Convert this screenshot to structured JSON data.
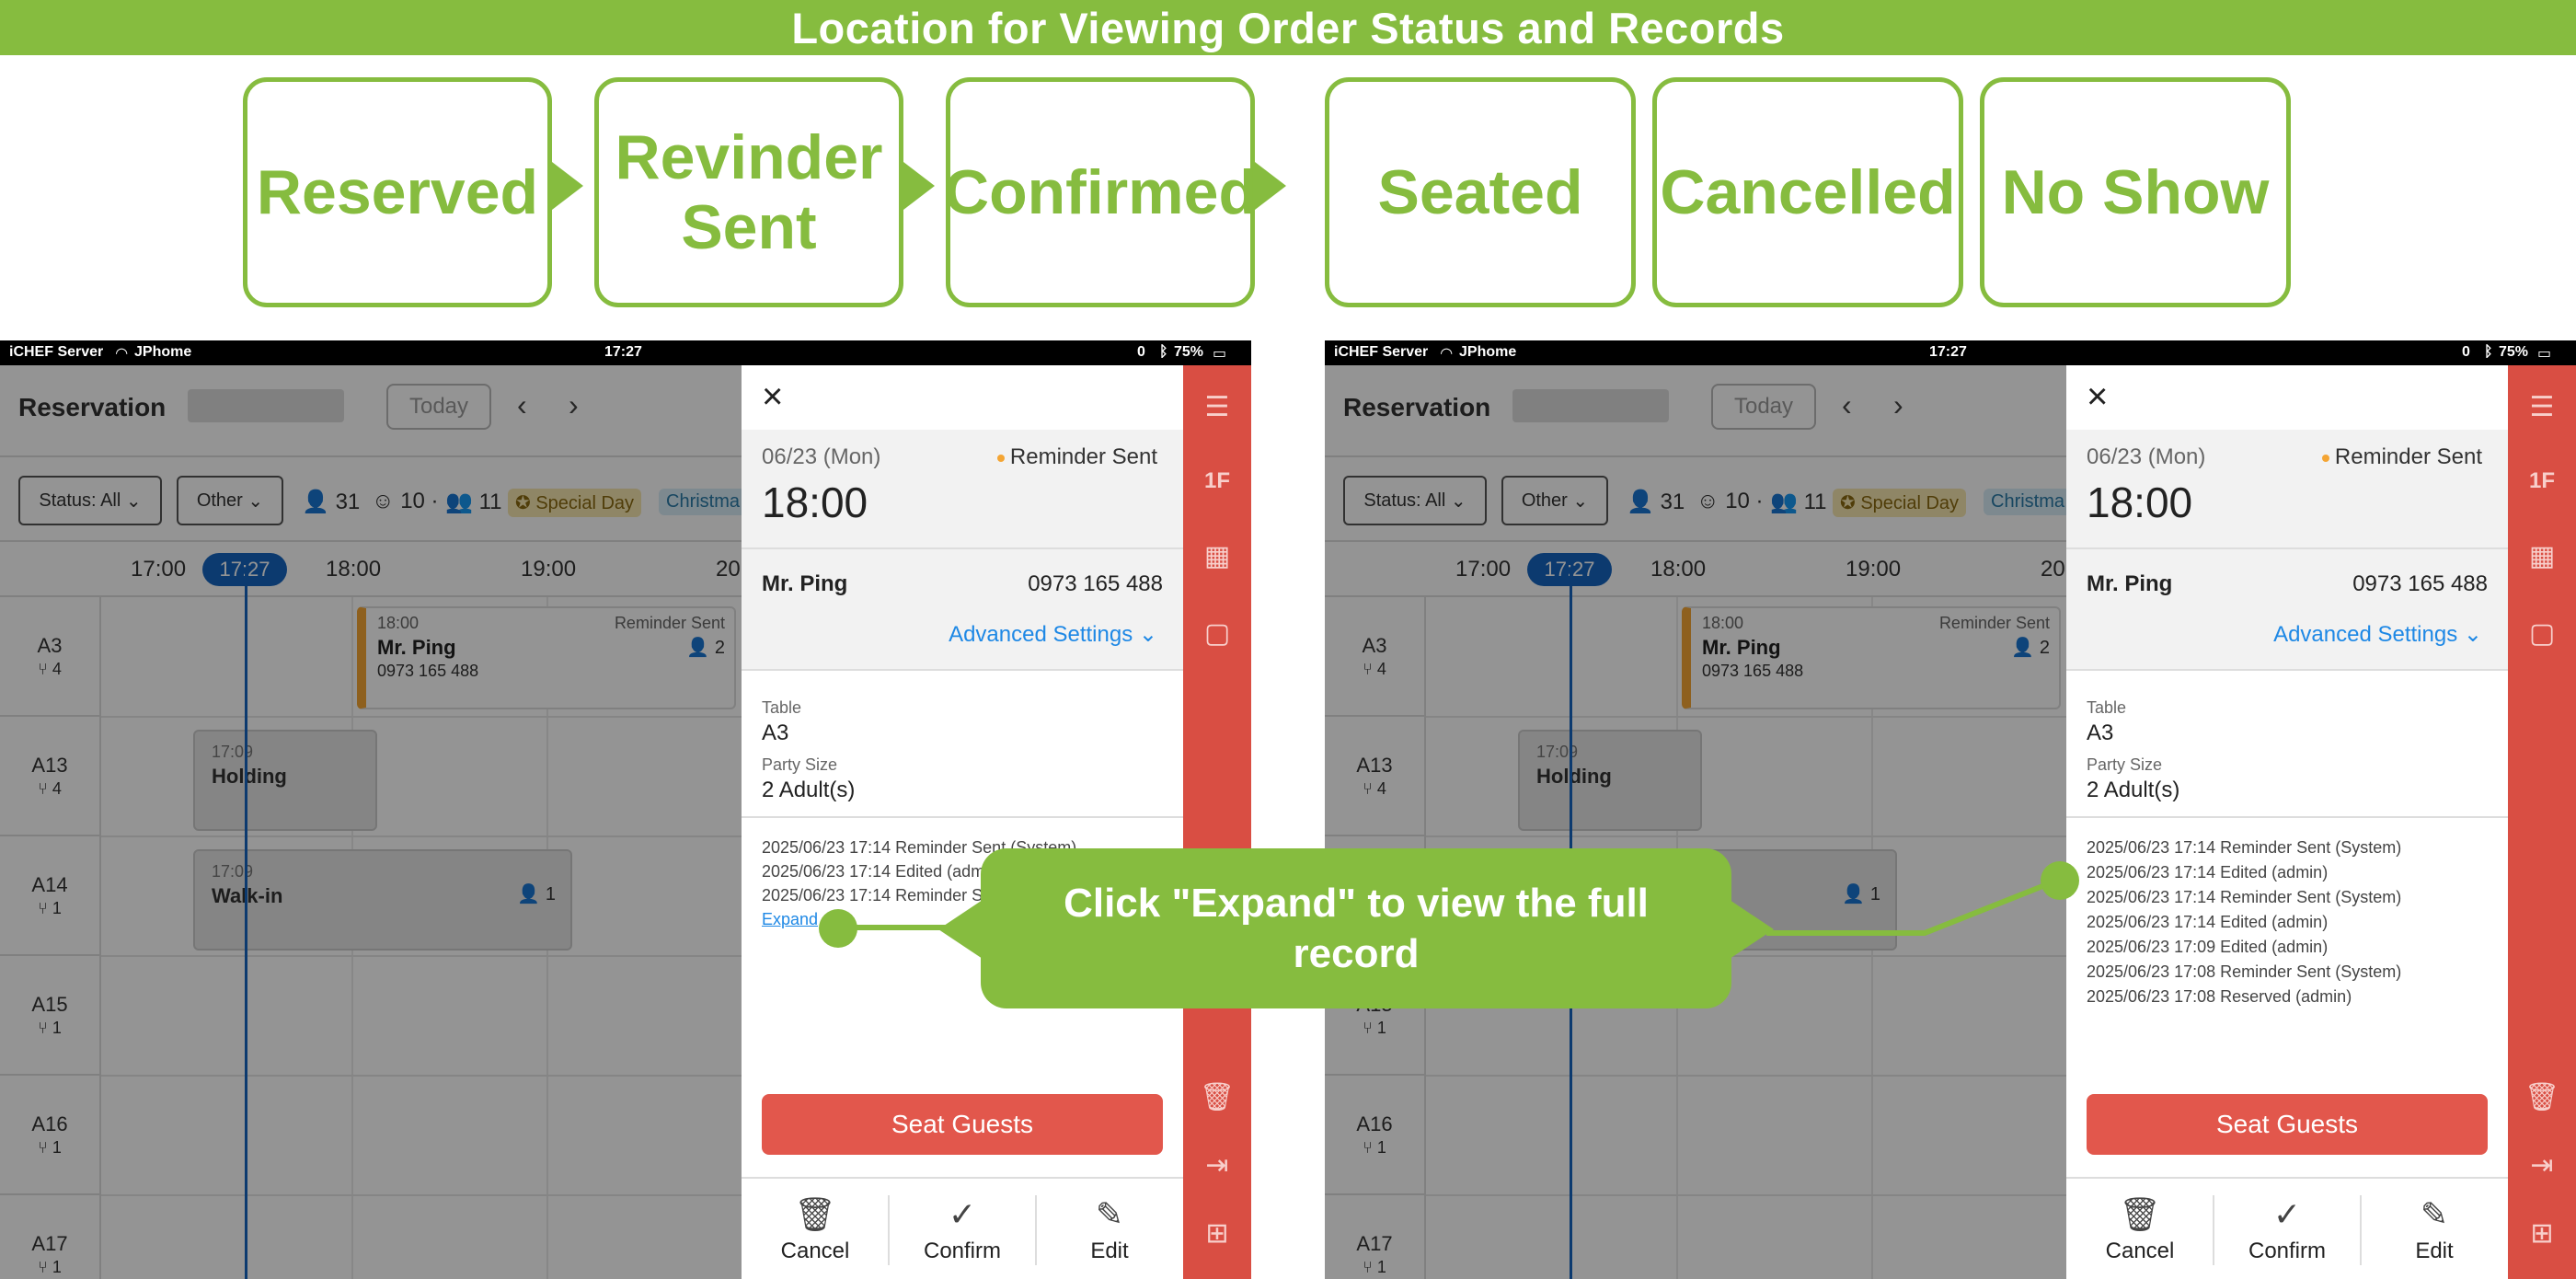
{
  "banner": {
    "title": "Location for Viewing Order Status and Records"
  },
  "statuses": [
    {
      "label": "Reserved"
    },
    {
      "label": "Revinder Sent"
    },
    {
      "label": "Confirmed"
    },
    {
      "label": "Seated"
    },
    {
      "label": "Cancelled"
    },
    {
      "label": "No Show"
    }
  ],
  "status_bar": {
    "carrier": "iCHEF Server",
    "wifi": "JPhome",
    "time": "17:27",
    "misc": "0",
    "battery": "75%"
  },
  "reservation": {
    "title": "Reservation",
    "today_label": "Today",
    "status_filter": "Status: All",
    "other_filter": "Other",
    "count_guests": "31",
    "count_a": "10",
    "count_b": "11",
    "special_day": "Special Day",
    "christmas": "Christma"
  },
  "timeline": {
    "hours": [
      "17:00",
      "18:00",
      "19:00",
      "20"
    ],
    "now": "17:27",
    "rows": [
      {
        "table": "A3",
        "cap": "4"
      },
      {
        "table": "A13",
        "cap": "4"
      },
      {
        "table": "A14",
        "cap": "1"
      },
      {
        "table": "A15",
        "cap": "1"
      },
      {
        "table": "A16",
        "cap": "1"
      },
      {
        "table": "A17",
        "cap": "1"
      }
    ],
    "booking": {
      "time": "18:00",
      "status": "Reminder Sent",
      "name": "Mr. Ping",
      "phone": "0973 165 488",
      "party": "2"
    },
    "holding": {
      "time": "17:09",
      "label": "Holding"
    },
    "walkin": {
      "time": "17:09",
      "label": "Walk-in",
      "party": "1"
    }
  },
  "panel": {
    "date": "06/23 (Mon)",
    "status": "Reminder Sent",
    "time": "18:00",
    "guest_name": "Mr. Ping",
    "guest_phone": "0973 165 488",
    "advanced_settings": "Advanced Settings",
    "table_label": "Table",
    "table_value": "A3",
    "party_label": "Party Size",
    "party_value": "2 Adult(s)",
    "log_collapsed": [
      "2025/06/23 17:14 Reminder Sent (System)",
      "2025/06/23 17:14 Edited (admin)",
      "2025/06/23 17:14 Reminder Sent (System)"
    ],
    "expand_label": "Expand",
    "log_full": [
      "2025/06/23 17:14 Reminder Sent (System)",
      "2025/06/23 17:14 Edited (admin)",
      "2025/06/23 17:14 Reminder Sent (System)",
      "2025/06/23 17:14 Edited (admin)",
      "2025/06/23 17:09 Edited (admin)",
      "2025/06/23 17:08 Reminder Sent (System)",
      "2025/06/23 17:08 Reserved (admin)"
    ],
    "seat_guests": "Seat Guests",
    "cancel": "Cancel",
    "confirm": "Confirm",
    "edit": "Edit"
  },
  "rail": {
    "floor": "1F"
  },
  "callout": {
    "text": "Click \"Expand\" to view the full record"
  },
  "colors": {
    "accent_green": "#86bc3f",
    "rail_red": "#d94e43",
    "seat_red": "#e2574c",
    "link_blue": "#1e88e5",
    "now_blue": "#1565c0",
    "reminder_orange": "#f4a534"
  }
}
